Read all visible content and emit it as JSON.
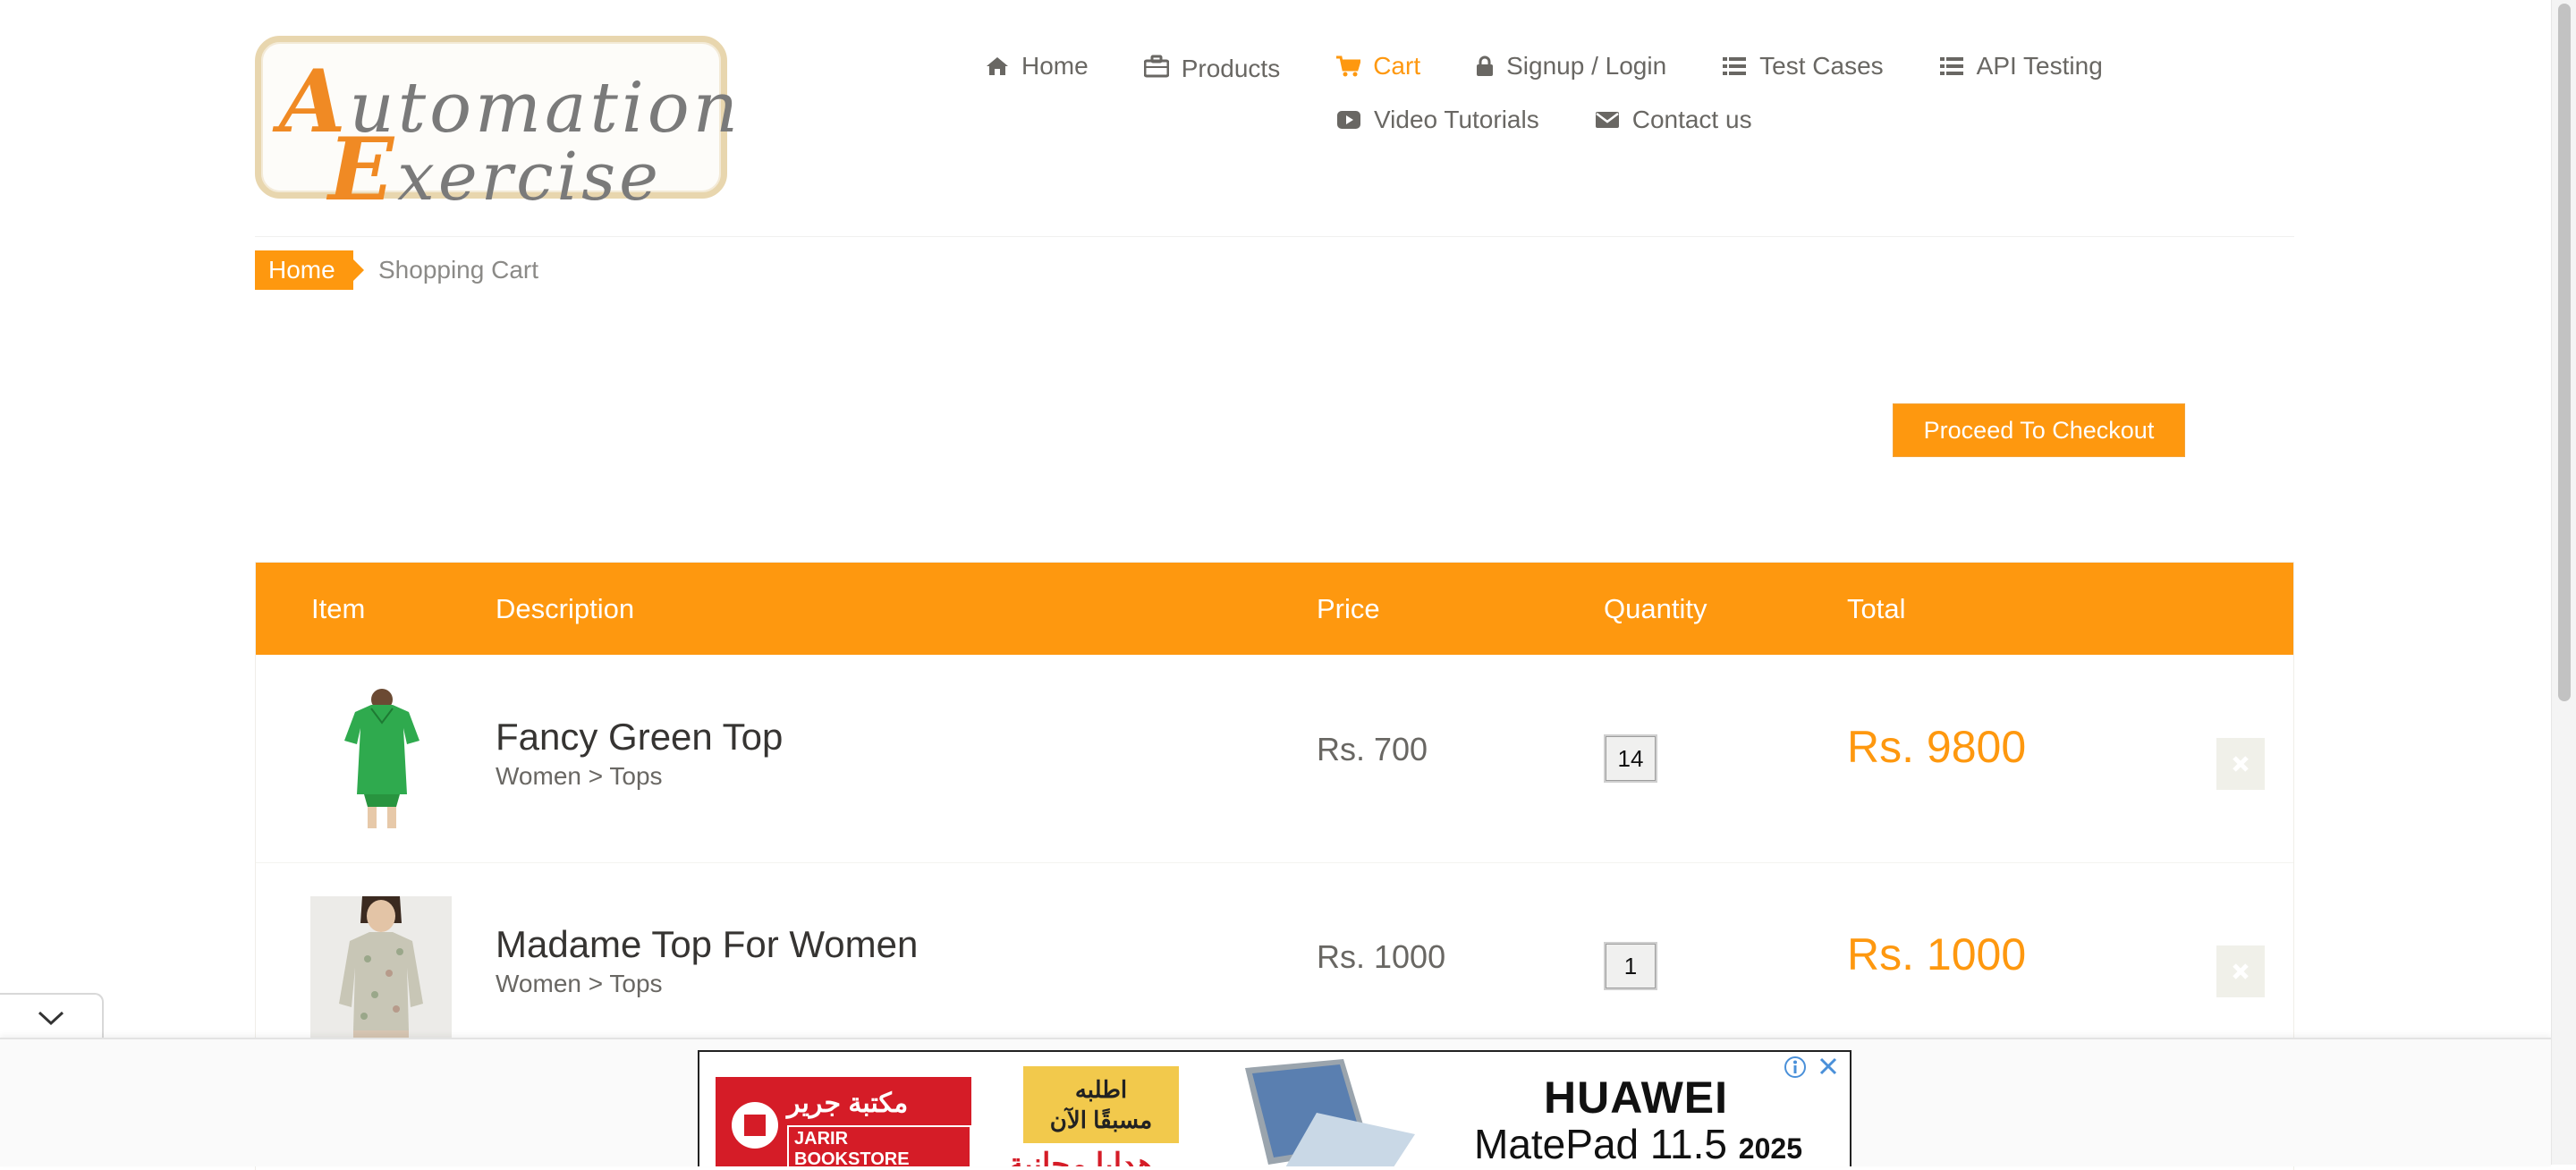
{
  "logo": {
    "line1": "utomation",
    "line1_cap": "A",
    "line2": "xercise",
    "line2_cap": "E"
  },
  "nav": {
    "items": [
      {
        "label": "Home",
        "icon": "home-icon"
      },
      {
        "label": "Products",
        "icon": "briefcase-icon"
      },
      {
        "label": "Cart",
        "icon": "shopping-cart-icon",
        "active": true
      },
      {
        "label": "Signup / Login",
        "icon": "lock-icon"
      },
      {
        "label": "Test Cases",
        "icon": "list-icon"
      },
      {
        "label": "API Testing",
        "icon": "list-icon"
      },
      {
        "label": "Video Tutorials",
        "icon": "youtube-play-icon"
      },
      {
        "label": "Contact us",
        "icon": "envelope-icon"
      }
    ]
  },
  "breadcrumb": {
    "home": "Home",
    "current": "Shopping Cart"
  },
  "checkout_button": "Proceed To Checkout",
  "table": {
    "headers": [
      "Item",
      "Description",
      "Price",
      "Quantity",
      "Total"
    ],
    "rows": [
      {
        "name": "Fancy Green Top",
        "category": "Women > Tops",
        "price": "Rs. 700",
        "quantity": "14",
        "total": "Rs. 9800",
        "image": "green-top-image"
      },
      {
        "name": "Madame Top For Women",
        "category": "Women > Tops",
        "price": "Rs. 1000",
        "quantity": "1",
        "total": "Rs. 1000",
        "image": "floral-top-image"
      }
    ]
  },
  "ad": {
    "jarir_ar": "مكتبة جرير",
    "jarir_en": "JARIR BOOKSTORE",
    "promo_line1": "اطلبه",
    "promo_line2": "مسبقًا الآن",
    "promo_red": "هدايا مجانية",
    "brand": "HUAWEI",
    "model": "MatePad 11.5",
    "year": "2025"
  },
  "colors": {
    "accent": "#fe980f",
    "text": "#696763",
    "heading": "#363432"
  }
}
